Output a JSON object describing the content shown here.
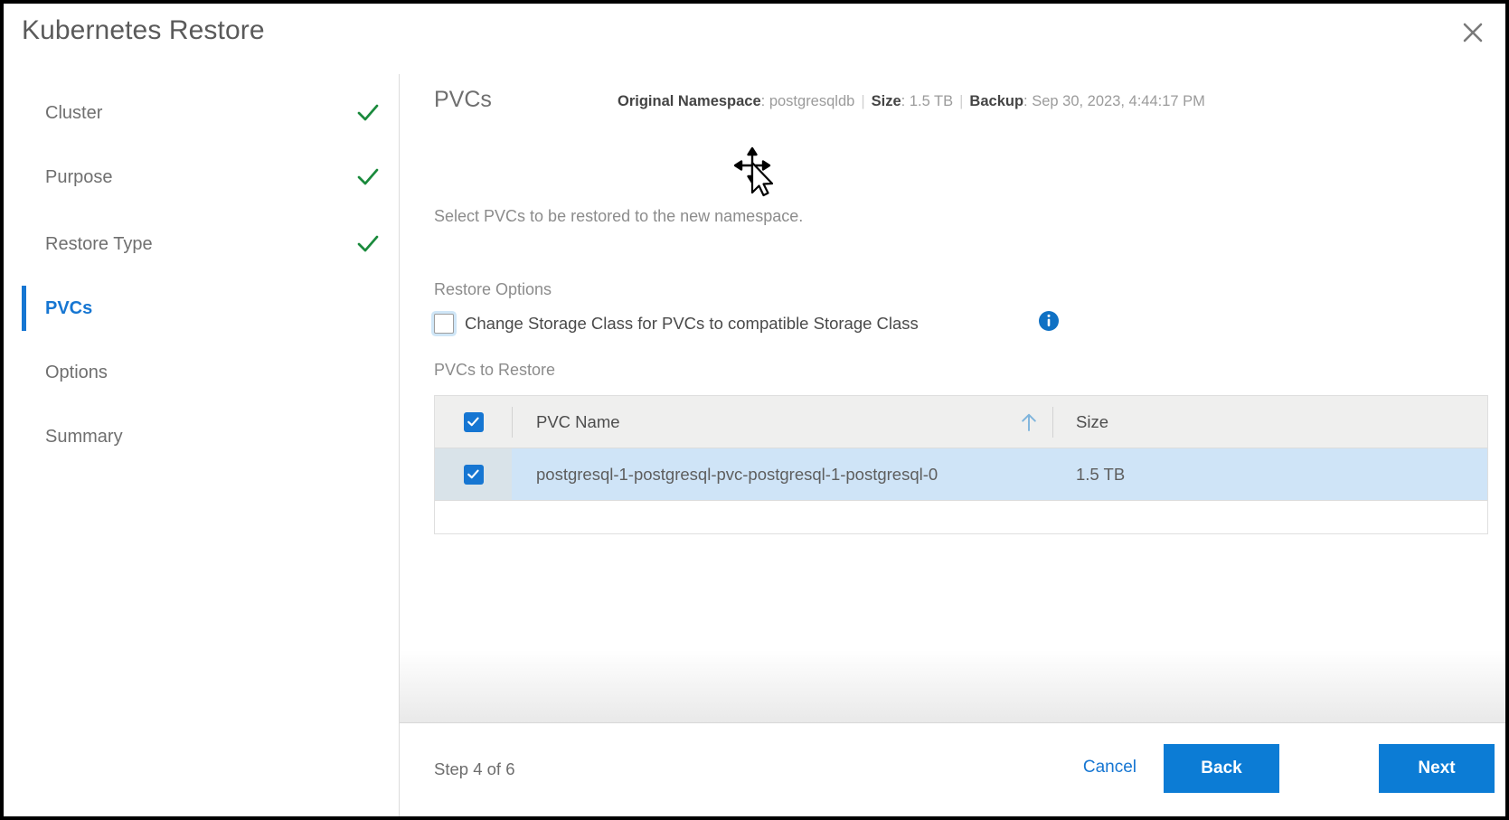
{
  "dialog": {
    "title": "Kubernetes Restore",
    "close_icon": "close-icon"
  },
  "steps": [
    {
      "label": "Cluster",
      "state": "complete",
      "icon": "check-icon"
    },
    {
      "label": "Purpose",
      "state": "complete",
      "icon": "check-icon"
    },
    {
      "label": "Restore Type",
      "state": "complete",
      "icon": "check-icon"
    },
    {
      "label": "PVCs",
      "state": "active",
      "icon": ""
    },
    {
      "label": "Options",
      "state": "pending",
      "icon": ""
    },
    {
      "label": "Summary",
      "state": "pending",
      "icon": ""
    }
  ],
  "panel": {
    "title": "PVCs",
    "meta": {
      "namespace_key": "Original Namespace",
      "namespace_value": "postgresqldb",
      "size_key": "Size",
      "size_value": "1.5 TB",
      "backup_key": "Backup",
      "backup_value": "Sep 30, 2023, 4:44:17 PM",
      "separator": "|"
    },
    "subtitle": "Select PVCs to be restored to the new namespace.",
    "restore_options_label": "Restore Options",
    "storage_class_checkbox": {
      "label": "Change Storage Class for PVCs to compatible Storage Class",
      "checked": false,
      "focused": true,
      "info_icon": "info-icon"
    },
    "pvcs_to_restore_label": "PVCs to Restore"
  },
  "table": {
    "select_all_checked": true,
    "sort_column": "PVC Name",
    "sort_direction": "ascending",
    "sort_icon": "arrow-up-icon",
    "columns": [
      "PVC Name",
      "Size"
    ],
    "rows": [
      {
        "checked": true,
        "selected": true,
        "name": "postgresql-1-postgresql-pvc-postgresql-1-postgresql-0",
        "size": "1.5 TB"
      }
    ]
  },
  "footer": {
    "step_counter": "Step 4 of 6",
    "cancel_label": "Cancel",
    "back_label": "Back",
    "next_label": "Next"
  },
  "cursor": {
    "icon": "move-cursor-icon"
  },
  "colors": {
    "accent_blue": "#1676d2",
    "button_blue": "#0c7cd5",
    "check_green": "#1a8a3c",
    "selected_row": "#cfe4f7",
    "header_gray": "#efefee",
    "text_gray": "#6f6f6f"
  }
}
